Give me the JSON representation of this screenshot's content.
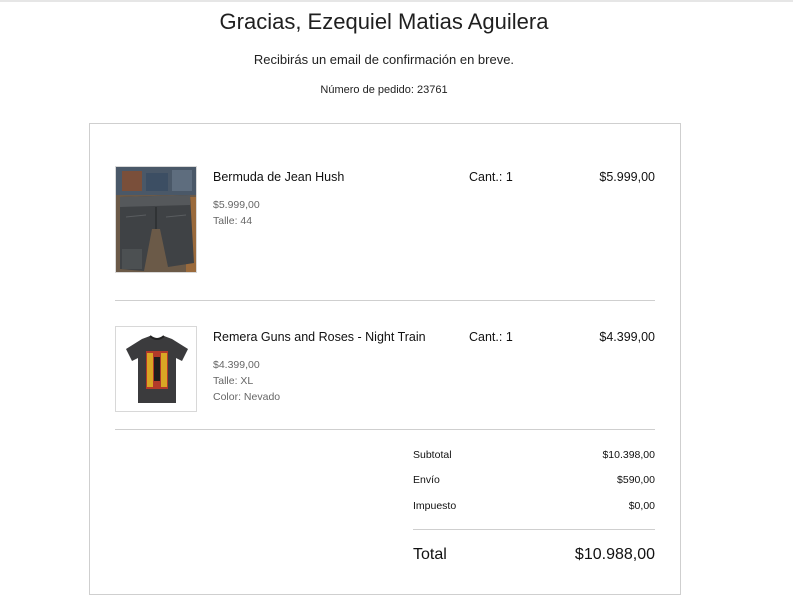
{
  "header": {
    "title": "Gracias, Ezequiel Matias Aguilera",
    "message": "Recibirás un email de confirmación en breve.",
    "order_number": "Número de pedido: 23761"
  },
  "items": [
    {
      "image": "jean-shorts-photo",
      "name": "Bermuda de Jean Hush",
      "qty": "Cant.: 1",
      "total": "$5.999,00",
      "unit_price": "$5.999,00",
      "size": "Talle: 44"
    },
    {
      "image": "band-tshirt-photo",
      "name": "Remera Guns and Roses - Night Train",
      "qty": "Cant.: 1",
      "total": "$4.399,00",
      "unit_price": "$4.399,00",
      "size": "Talle: XL",
      "color": "Color: Nevado"
    }
  ],
  "summary": {
    "subtotal_label": "Subtotal",
    "subtotal_value": "$10.398,00",
    "shipping_label": "Envío",
    "shipping_value": "$590,00",
    "tax_label": "Impuesto",
    "tax_value": "$0,00",
    "total_label": "Total",
    "total_value": "$10.988,00"
  }
}
